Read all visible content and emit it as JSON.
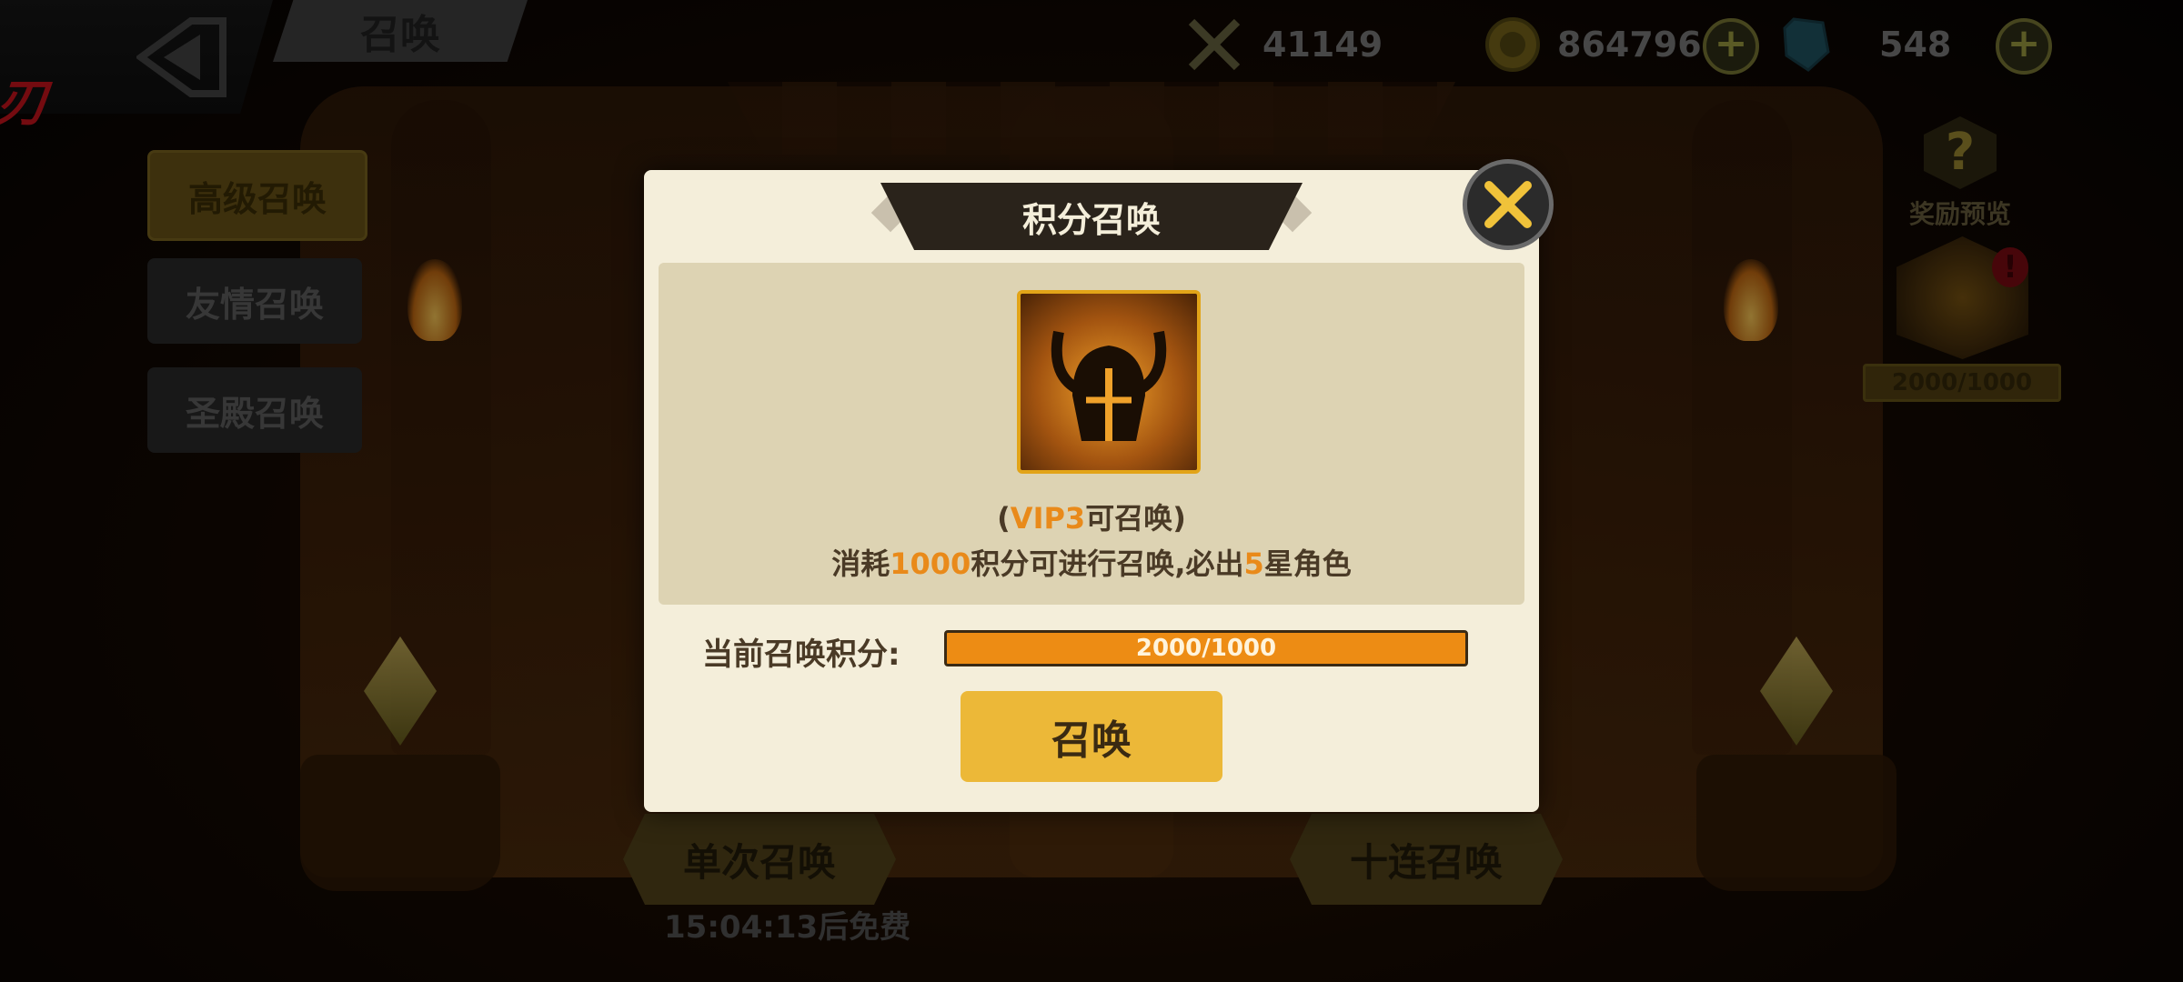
{
  "header": {
    "title": "召唤",
    "red_mark": "刃",
    "resources": [
      {
        "name": "power",
        "icon": "crossed-swords-icon",
        "value": "41149"
      },
      {
        "name": "gold",
        "icon": "gold-coin-icon",
        "value": "864796"
      },
      {
        "name": "gems",
        "icon": "blue-gem-icon",
        "value": "548"
      }
    ],
    "plus_label": "+"
  },
  "menu": {
    "items": [
      "高级召唤",
      "友情召唤",
      "圣殿召唤"
    ],
    "active_index": 0
  },
  "side": {
    "reward_preview_label": "奖励预览",
    "reward_progress": "2000/1000",
    "alert": "!"
  },
  "bottom": {
    "single_label": "单次召唤",
    "ten_label": "十连召唤",
    "free_timer": "15:04:13后免费"
  },
  "modal": {
    "title": "积分召唤",
    "line1_prefix": "(",
    "line1_vip": "VIP3",
    "line1_suffix": "可召唤)",
    "line2_part1": "消耗",
    "line2_cost": "1000",
    "line2_part2": "积分可进行召唤,必出",
    "line2_star": "5",
    "line2_part3": "星角色",
    "points_label": "当前召唤积分:",
    "progress_text": "2000/1000",
    "progress_fraction": 1.0,
    "summon_label": "召唤"
  },
  "colors": {
    "accent_orange": "#e98a1a",
    "button_gold": "#ecb838",
    "panel_bg": "#f4eeda"
  }
}
